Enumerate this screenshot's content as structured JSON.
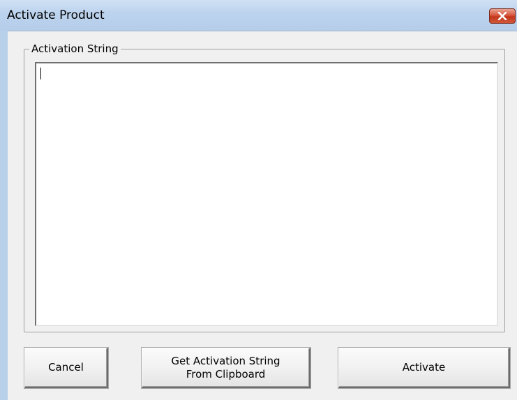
{
  "window": {
    "title": "Activate Product",
    "close_icon": "close-icon"
  },
  "group": {
    "label": "Activation String"
  },
  "input": {
    "value": "",
    "placeholder": ""
  },
  "buttons": {
    "cancel_label": "Cancel",
    "clipboard_line1": "Get Activation String",
    "clipboard_line2": "From Clipboard",
    "activate_label": "Activate"
  },
  "colors": {
    "titlebar": "#bcd3ee",
    "close_button": "#c7452a",
    "dialog_background": "#f0f0f0"
  }
}
